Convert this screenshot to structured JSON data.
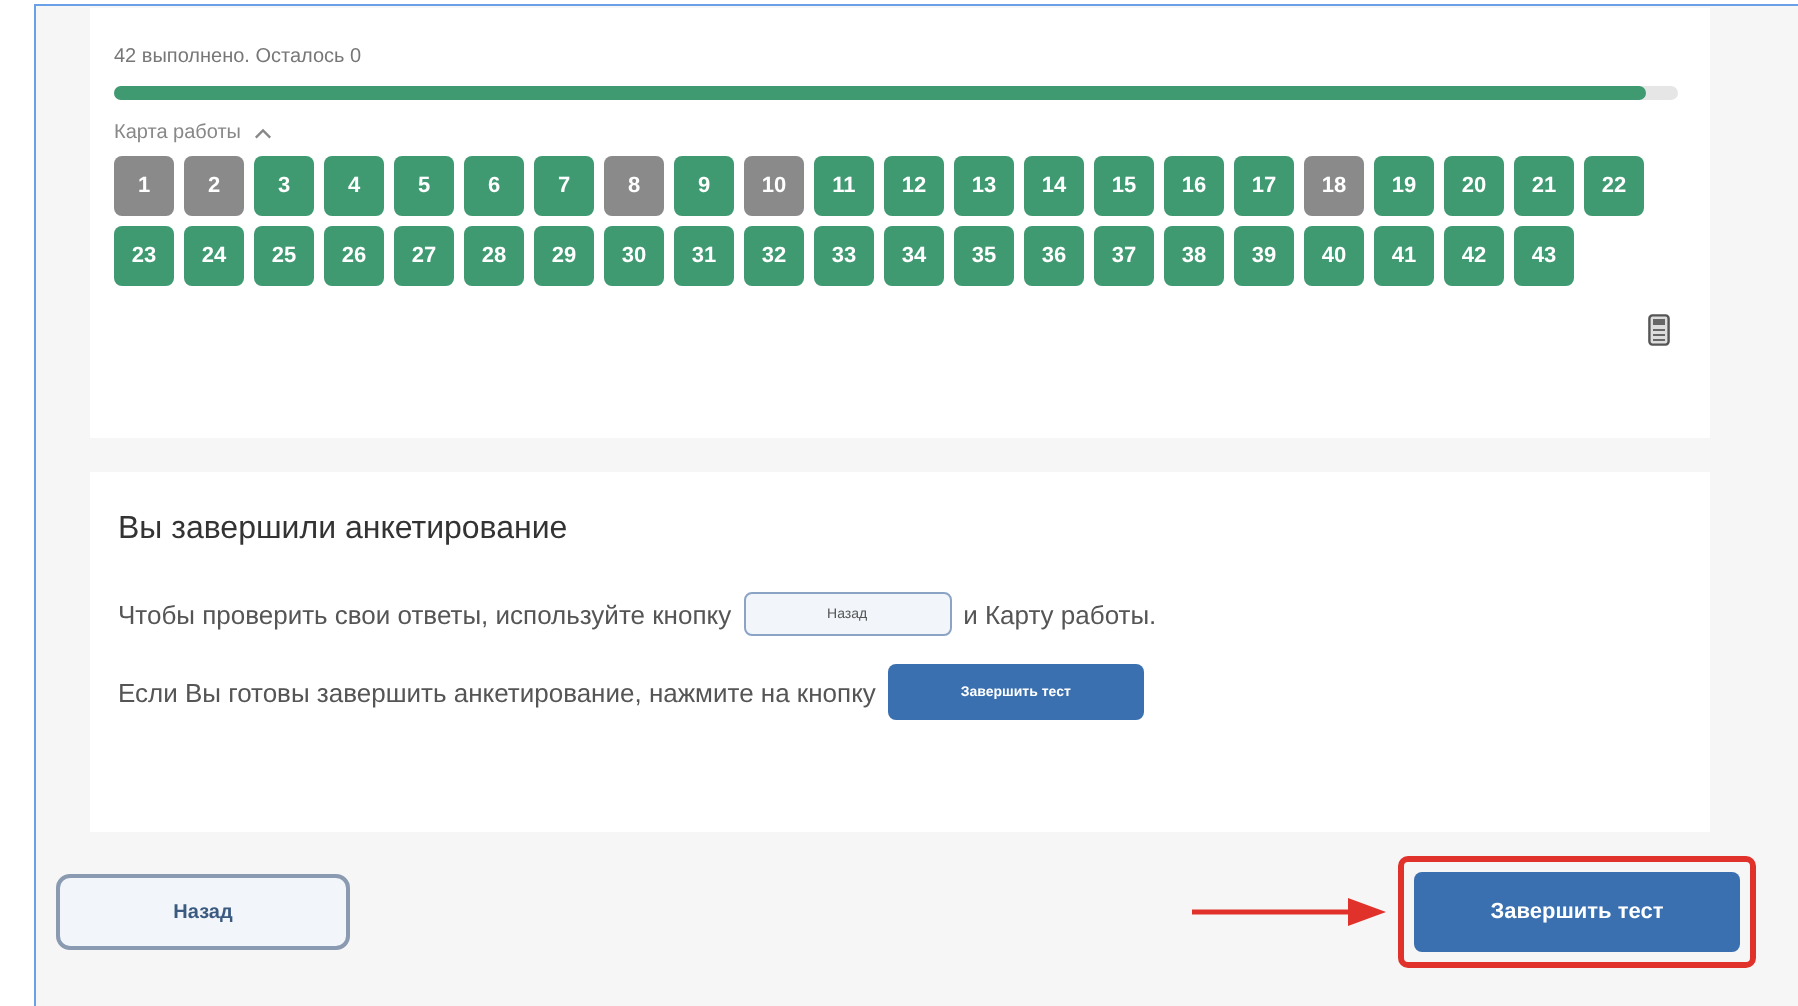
{
  "progress": {
    "summary": "42 выполнено. Осталось 0",
    "level": 0.98
  },
  "work_map": {
    "label": "Карта работы",
    "expanded": true,
    "items": [
      {
        "number": "1",
        "answered": false
      },
      {
        "number": "2",
        "answered": false
      },
      {
        "number": "3",
        "answered": true
      },
      {
        "number": "4",
        "answered": true
      },
      {
        "number": "5",
        "answered": true
      },
      {
        "number": "6",
        "answered": true
      },
      {
        "number": "7",
        "answered": true
      },
      {
        "number": "8",
        "answered": false
      },
      {
        "number": "9",
        "answered": true
      },
      {
        "number": "10",
        "answered": false
      },
      {
        "number": "11",
        "answered": true
      },
      {
        "number": "12",
        "answered": true
      },
      {
        "number": "13",
        "answered": true
      },
      {
        "number": "14",
        "answered": true
      },
      {
        "number": "15",
        "answered": true
      },
      {
        "number": "16",
        "answered": true
      },
      {
        "number": "17",
        "answered": true
      },
      {
        "number": "18",
        "answered": false
      },
      {
        "number": "19",
        "answered": true
      },
      {
        "number": "20",
        "answered": true
      },
      {
        "number": "21",
        "answered": true
      },
      {
        "number": "22",
        "answered": true
      },
      {
        "number": "23",
        "answered": true
      },
      {
        "number": "24",
        "answered": true
      },
      {
        "number": "25",
        "answered": true
      },
      {
        "number": "26",
        "answered": true
      },
      {
        "number": "27",
        "answered": true
      },
      {
        "number": "28",
        "answered": true
      },
      {
        "number": "29",
        "answered": true
      },
      {
        "number": "30",
        "answered": true
      },
      {
        "number": "31",
        "answered": true
      },
      {
        "number": "32",
        "answered": true
      },
      {
        "number": "33",
        "answered": true
      },
      {
        "number": "34",
        "answered": true
      },
      {
        "number": "35",
        "answered": true
      },
      {
        "number": "36",
        "answered": true
      },
      {
        "number": "37",
        "answered": true
      },
      {
        "number": "38",
        "answered": true
      },
      {
        "number": "39",
        "answered": true
      },
      {
        "number": "40",
        "answered": true
      },
      {
        "number": "41",
        "answered": true
      },
      {
        "number": "42",
        "answered": true
      },
      {
        "number": "43",
        "answered": true
      }
    ]
  },
  "completion": {
    "title": "Вы завершили анкетирование",
    "line_1": {
      "before": "Чтобы проверить свои ответы, используйте кнопку",
      "button": "Назад",
      "after": "и Карту работы."
    },
    "line_2": {
      "before": "Если Вы готовы завершить анкетирование, нажмите на кнопку",
      "button": "Завершить тест"
    }
  },
  "footer": {
    "back_button": "Назад",
    "finish_button": "Завершить тест",
    "finish_highlighted": true
  }
}
